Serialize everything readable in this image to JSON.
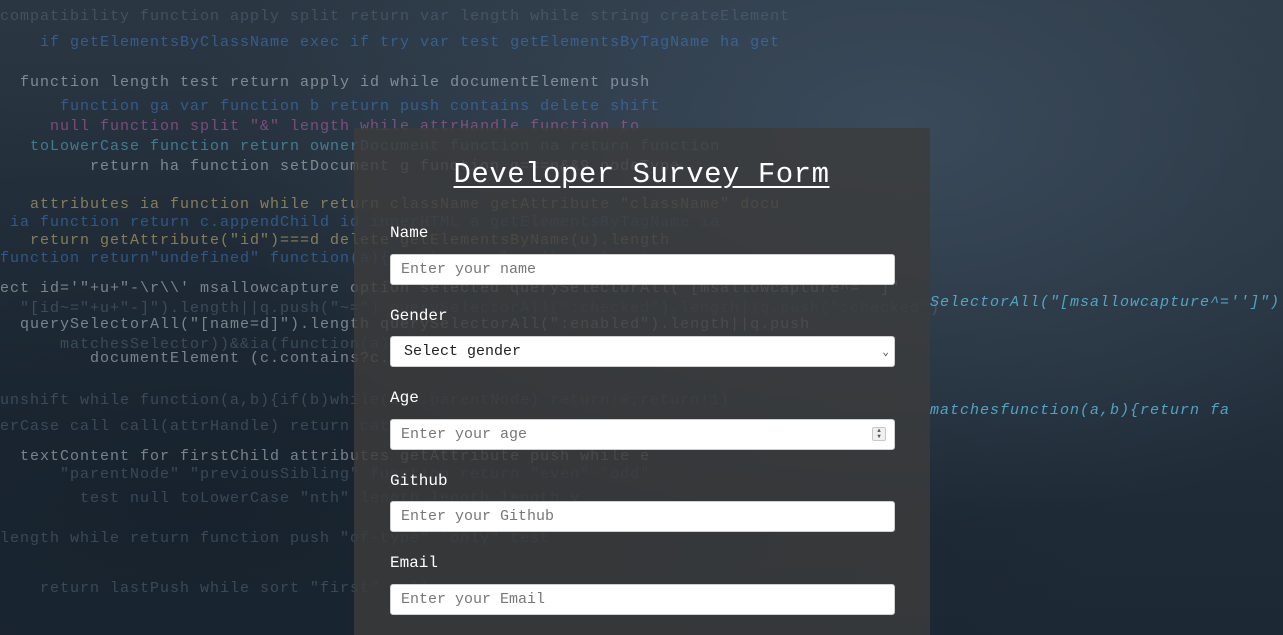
{
  "form": {
    "title": "Developer Survey Form",
    "fields": {
      "name": {
        "label": "Name",
        "placeholder": "Enter your name"
      },
      "gender": {
        "label": "Gender",
        "selected": "Select gender"
      },
      "age": {
        "label": "Age",
        "placeholder": "Enter your age"
      },
      "github": {
        "label": "Github",
        "placeholder": "Enter your Github"
      },
      "email": {
        "label": "Email",
        "placeholder": "Enter your Email"
      }
    }
  },
  "icons": {
    "select_chevron": "chevron-down-icon",
    "number_spinner": "spinner-icon"
  },
  "colors": {
    "panel": "#3c3c3c",
    "text": "#ffffff",
    "background": "#1e2a36"
  }
}
